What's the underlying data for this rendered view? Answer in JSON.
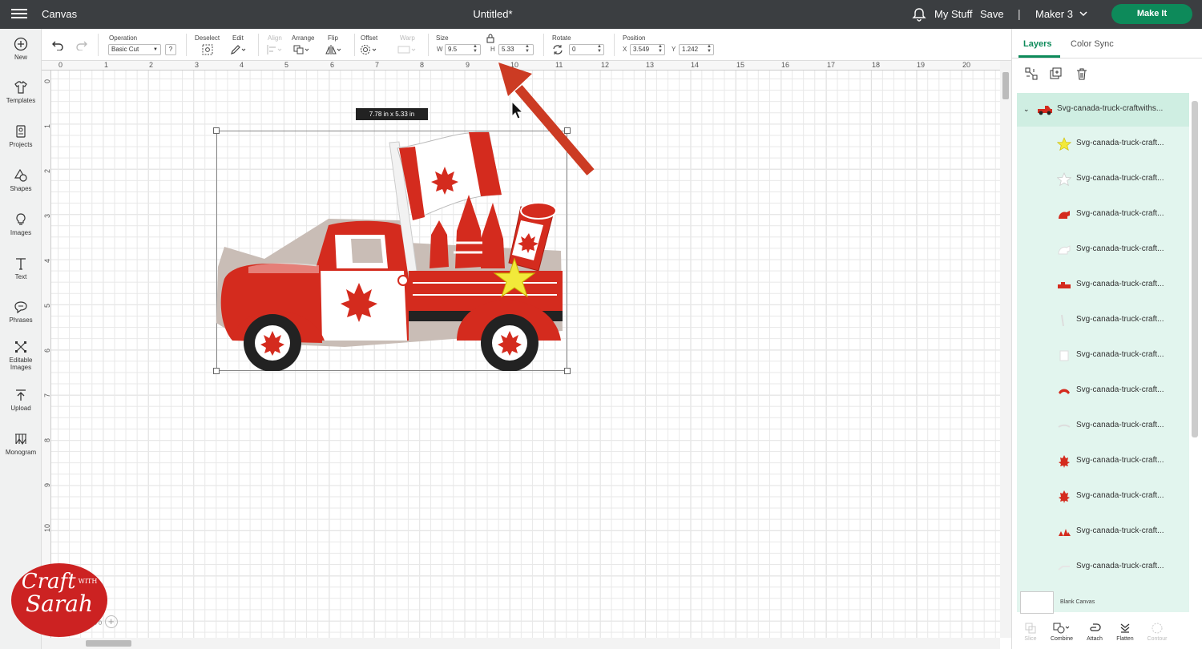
{
  "header": {
    "app_name": "Canvas",
    "doc_title": "Untitled*",
    "my_stuff": "My Stuff",
    "save": "Save",
    "separator": "|",
    "machine": "Maker 3",
    "make_it": "Make It"
  },
  "toolbar": {
    "operation_label": "Operation",
    "operation_value": "Basic Cut",
    "help": "?",
    "deselect_label": "Deselect",
    "edit_label": "Edit",
    "align_label": "Align",
    "arrange_label": "Arrange",
    "flip_label": "Flip",
    "offset_label": "Offset",
    "warp_label": "Warp",
    "size_label": "Size",
    "w_label": "W",
    "w_value": "9.5",
    "h_label": "H",
    "h_value": "5.33",
    "rotate_label": "Rotate",
    "rotate_value": "0",
    "position_label": "Position",
    "x_label": "X",
    "x_value": "3.549",
    "y_label": "Y",
    "y_value": "1.242"
  },
  "sidebar": {
    "items": [
      {
        "label": "New",
        "icon": "plus-icon"
      },
      {
        "label": "Templates",
        "icon": "shirt-icon"
      },
      {
        "label": "Projects",
        "icon": "projects-icon"
      },
      {
        "label": "Shapes",
        "icon": "shapes-icon"
      },
      {
        "label": "Images",
        "icon": "bulb-icon"
      },
      {
        "label": "Text",
        "icon": "text-icon"
      },
      {
        "label": "Phrases",
        "icon": "chat-icon"
      },
      {
        "label": "Editable Images",
        "icon": "editable-icon"
      },
      {
        "label": "Upload",
        "icon": "upload-icon"
      },
      {
        "label": "Monogram",
        "icon": "monogram-icon"
      }
    ]
  },
  "canvas": {
    "ruler_top": [
      "0",
      "1",
      "2",
      "3",
      "4",
      "5",
      "6",
      "7",
      "8",
      "9",
      "10",
      "11",
      "12",
      "13",
      "14",
      "15",
      "16",
      "17",
      "18",
      "19",
      "20"
    ],
    "ruler_left": [
      "0",
      "1",
      "2",
      "3",
      "4",
      "5",
      "6",
      "7",
      "8",
      "9",
      "10"
    ],
    "dimension_tag": "7.78  in x 5.33  in",
    "zoom": "0%"
  },
  "panel": {
    "tab_layers": "Layers",
    "tab_color_sync": "Color Sync",
    "group_name": "Svg-canada-truck-craftwiths...",
    "layers": [
      {
        "name": "Svg-canada-truck-craft...",
        "color": "#f2e93a"
      },
      {
        "name": "Svg-canada-truck-craft...",
        "color": "#ffffff"
      },
      {
        "name": "Svg-canada-truck-craft...",
        "color": "#d42b1e"
      },
      {
        "name": "Svg-canada-truck-craft...",
        "color": "#ffffff"
      },
      {
        "name": "Svg-canada-truck-craft...",
        "color": "#d42b1e"
      },
      {
        "name": "Svg-canada-truck-craft...",
        "color": "#ffffff"
      },
      {
        "name": "Svg-canada-truck-craft...",
        "color": "#ffffff"
      },
      {
        "name": "Svg-canada-truck-craft...",
        "color": "#d42b1e"
      },
      {
        "name": "Svg-canada-truck-craft...",
        "color": "#ffffff"
      },
      {
        "name": "Svg-canada-truck-craft...",
        "color": "#d42b1e"
      },
      {
        "name": "Svg-canada-truck-craft...",
        "color": "#d42b1e"
      },
      {
        "name": "Svg-canada-truck-craft...",
        "color": "#d42b1e"
      },
      {
        "name": "Svg-canada-truck-craft...",
        "color": "#ffffff"
      }
    ],
    "blank_canvas": "Blank Canvas",
    "bottom_tools": [
      "Slice",
      "Combine",
      "Attach",
      "Flatten",
      "Contour"
    ]
  },
  "logo": {
    "line1": "Craft",
    "line2": "WITH",
    "line3": "Sarah"
  },
  "colors": {
    "accent": "#0d8a5a",
    "topbar": "#3b3e41",
    "red": "#d42b1e",
    "arrow": "#cc3b23"
  }
}
